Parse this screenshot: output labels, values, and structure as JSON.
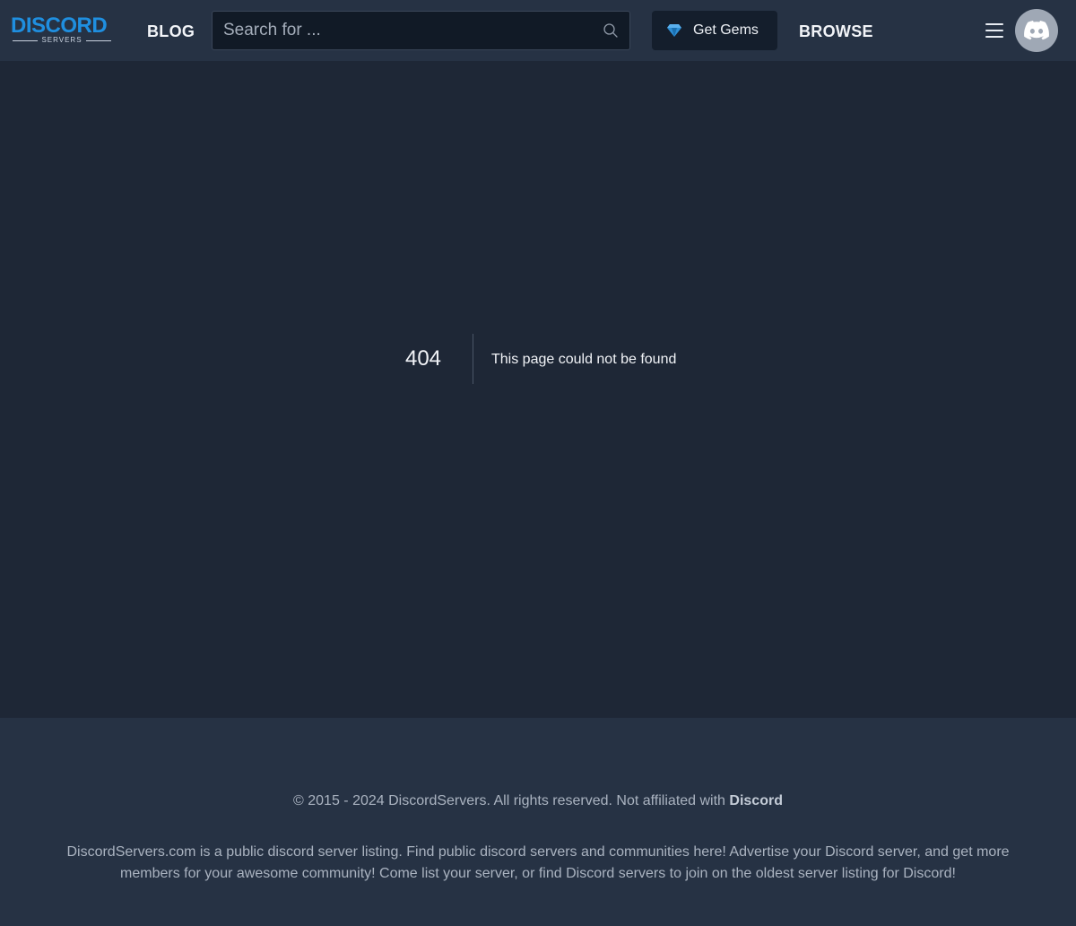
{
  "header": {
    "logo_text": "DISCORD",
    "logo_subtext": "SERVERS",
    "blog_label": "BLOG",
    "search_placeholder": "Search for ...",
    "gems_label": "Get Gems",
    "browse_label": "BROWSE",
    "icons": [
      "search-icon",
      "gem-icon",
      "menu-icon",
      "discord-icon"
    ]
  },
  "error": {
    "code": "404",
    "message": "This page could not be found"
  },
  "footer": {
    "copyright_prefix": "© 2015 - 2024 DiscordServers. All rights reserved. Not affiliated with",
    "copyright_brand": "Discord",
    "about": "DiscordServers.com is a public discord server listing. Find public discord servers and communities here! Advertise your Discord server, and get more members for your awesome community! Come list your server, or find Discord servers to join on the oldest server listing for Discord!"
  },
  "colors": {
    "background": "#1e2736",
    "header": "#263244",
    "logo_blue": "#1f8fe0",
    "gem": "#2e8fd6"
  }
}
